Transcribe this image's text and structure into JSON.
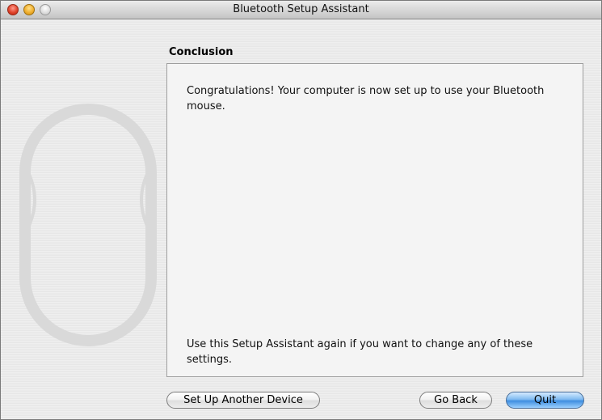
{
  "window": {
    "title": "Bluetooth Setup Assistant"
  },
  "page": {
    "heading": "Conclusion",
    "message": "Congratulations! Your computer is now set up to use your Bluetooth mouse.",
    "footer_note": "Use this Setup Assistant again if you want to change any of these settings."
  },
  "buttons": {
    "setup_another": "Set Up Another Device",
    "go_back": "Go Back",
    "quit": "Quit"
  },
  "icons": {
    "close": "close-icon",
    "minimize": "minimize-icon",
    "zoom": "zoom-icon",
    "watermark": "bluetooth-mouse-icon"
  },
  "colors": {
    "close": "#e0442c",
    "minimize": "#f0b030",
    "zoom": "#dcdcdc",
    "default_button": "#3f8ee0"
  }
}
